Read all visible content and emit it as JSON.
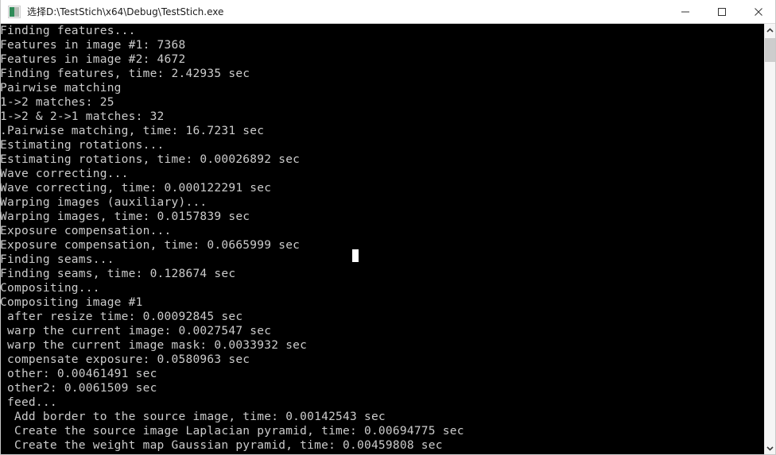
{
  "window": {
    "title": "选择D:\\TestStich\\x64\\Debug\\TestStich.exe",
    "icon": "console-app-icon",
    "background_color": "#000000",
    "titlebar_color": "#ffffff"
  },
  "caption_buttons": {
    "minimize_label": "—",
    "maximize_label": "□",
    "close_label": "✕",
    "minimize_name": "minimize-button",
    "maximize_name": "maximize-button",
    "close_name": "close-button"
  },
  "console": {
    "foreground_color": "#cccccc",
    "background_color": "#000000",
    "cursor_visible": true,
    "lines": [
      "Finding features...",
      "Features in image #1: 7368",
      "Features in image #2: 4672",
      "Finding features, time: 2.42935 sec",
      "Pairwise matching",
      "1->2 matches: 25",
      "1->2 & 2->1 matches: 32",
      ".Pairwise matching, time: 16.7231 sec",
      "Estimating rotations...",
      "Estimating rotations, time: 0.00026892 sec",
      "Wave correcting...",
      "Wave correcting, time: 0.000122291 sec",
      "Warping images (auxiliary)...",
      "Warping images, time: 0.0157839 sec",
      "Exposure compensation...",
      "Exposure compensation, time: 0.0665999 sec",
      "Finding seams...",
      "Finding seams, time: 0.128674 sec",
      "Compositing...",
      "Compositing image #1",
      " after resize time: 0.00092845 sec",
      " warp the current image: 0.0027547 sec",
      " warp the current image mask: 0.0033932 sec",
      " compensate exposure: 0.0580963 sec",
      " other: 0.00461491 sec",
      " other2: 0.0061509 sec",
      " feed...",
      "  Add border to the source image, time: 0.00142543 sec",
      "  Create the source image Laplacian pyramid, time: 0.00694775 sec",
      "  Create the weight map Gaussian pyramid, time: 0.00459808 sec"
    ]
  },
  "scrollbar": {
    "up_arrow_icon": "chevron-up-icon",
    "down_arrow_icon": "chevron-down-icon",
    "thumb_position_percent": 3,
    "thumb_color": "#cdcdcd",
    "track_color": "#f5f5f5"
  }
}
